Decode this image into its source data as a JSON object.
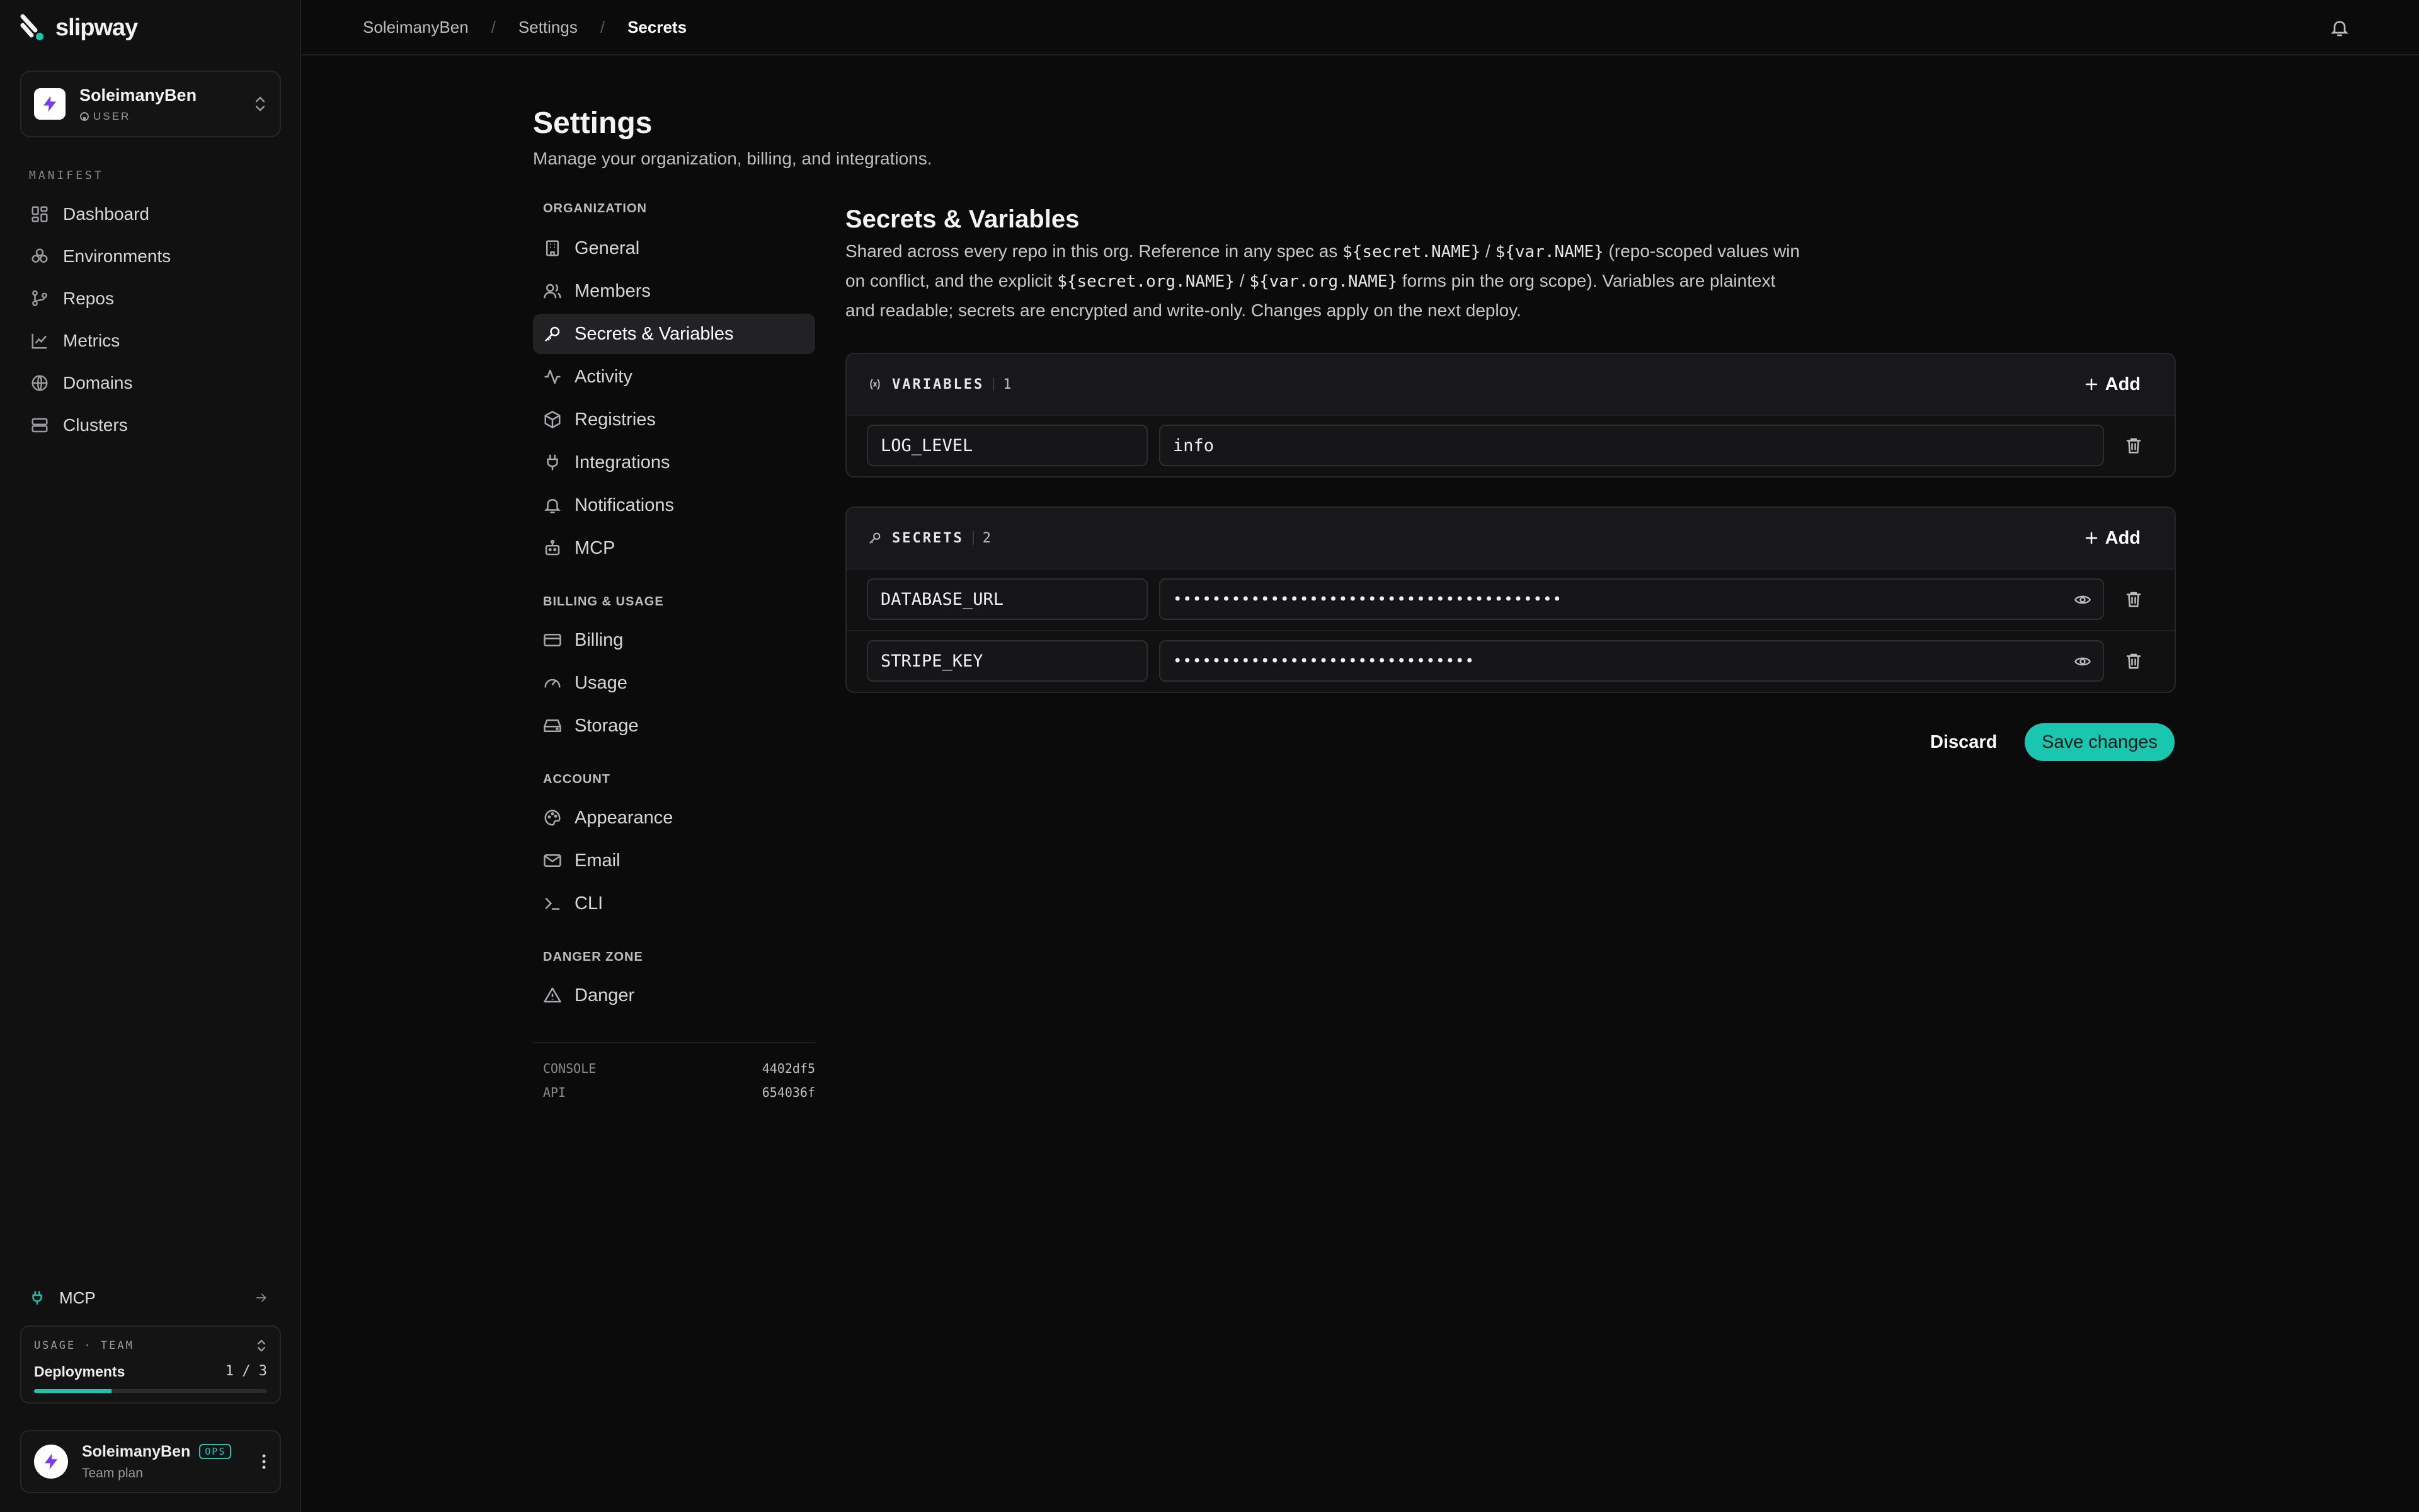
{
  "app": {
    "name": "slipway"
  },
  "org_switcher": {
    "name": "SoleimanyBen",
    "type": "USER"
  },
  "sidebar": {
    "section": "MANIFEST",
    "items": [
      {
        "label": "Dashboard",
        "icon": "grid-icon"
      },
      {
        "label": "Environments",
        "icon": "environments-icon"
      },
      {
        "label": "Repos",
        "icon": "git-branch-icon"
      },
      {
        "label": "Metrics",
        "icon": "chart-icon"
      },
      {
        "label": "Domains",
        "icon": "globe-icon"
      },
      {
        "label": "Clusters",
        "icon": "server-icon"
      }
    ],
    "mcp_label": "MCP",
    "usage": {
      "title": "USAGE · TEAM",
      "metric": "Deployments",
      "value": "1 / 3",
      "progress": 0.333
    },
    "user": {
      "name": "SoleimanyBen",
      "badge": "OPS",
      "plan": "Team plan"
    }
  },
  "breadcrumb": [
    "SoleimanyBen",
    "Settings",
    "Secrets"
  ],
  "page": {
    "title": "Settings",
    "subtitle": "Manage your organization, billing, and integrations."
  },
  "settings_nav": {
    "groups": [
      {
        "label": "ORGANIZATION",
        "items": [
          "General",
          "Members",
          "Secrets & Variables",
          "Activity",
          "Registries",
          "Integrations",
          "Notifications",
          "MCP"
        ]
      },
      {
        "label": "BILLING & USAGE",
        "items": [
          "Billing",
          "Usage",
          "Storage"
        ]
      },
      {
        "label": "ACCOUNT",
        "items": [
          "Appearance",
          "Email",
          "CLI"
        ]
      },
      {
        "label": "DANGER ZONE",
        "items": [
          "Danger"
        ]
      }
    ],
    "active": "Secrets & Variables",
    "versions": [
      {
        "label": "CONSOLE",
        "value": "4402df5"
      },
      {
        "label": "API",
        "value": "654036f"
      }
    ]
  },
  "section": {
    "title": "Secrets & Variables",
    "desc": {
      "t1": "Shared across every repo in this org. Reference in any spec as ",
      "c1": "${secret.NAME}",
      "t2": " / ",
      "c2": "${var.NAME}",
      "t3": " (repo-scoped values win on conflict, and the explicit ",
      "c3": "${secret.org.NAME}",
      "t4": " / ",
      "c4": "${var.org.NAME}",
      "t5": " forms pin the org scope). Variables are plaintext and readable; secrets are encrypted and write-only. Changes apply on the next deploy."
    }
  },
  "variables": {
    "title": "VARIABLES",
    "count": "1",
    "add_label": "Add",
    "rows": [
      {
        "key": "LOG_LEVEL",
        "value": "info"
      }
    ]
  },
  "secrets": {
    "title": "SECRETS",
    "count": "2",
    "add_label": "Add",
    "rows": [
      {
        "key": "DATABASE_URL",
        "masked": "••••••••••••••••••••••••••••••••••••••••"
      },
      {
        "key": "STRIPE_KEY",
        "masked": "•••••••••••••••••••••••••••••••"
      }
    ]
  },
  "actions": {
    "discard": "Discard",
    "save": "Save changes"
  },
  "colors": {
    "accent": "#19c6b0",
    "background": "#0b0b0c"
  }
}
